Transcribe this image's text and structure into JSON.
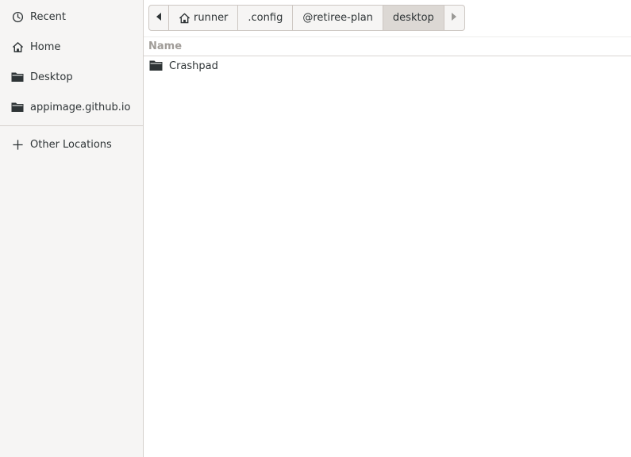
{
  "sidebar": {
    "items": [
      {
        "label": "Recent",
        "icon": "clock-icon"
      },
      {
        "label": "Home",
        "icon": "home-icon"
      },
      {
        "label": "Desktop",
        "icon": "folder-icon"
      },
      {
        "label": "appimage.github.io",
        "icon": "folder-icon"
      }
    ],
    "other_locations": {
      "label": "Other Locations",
      "icon": "plus-icon"
    }
  },
  "pathbar": {
    "segments": [
      {
        "label": "runner",
        "icon": "home-icon"
      },
      {
        "label": ".config"
      },
      {
        "label": "@retiree-plan"
      },
      {
        "label": "desktop",
        "active": true
      }
    ]
  },
  "list": {
    "columns": [
      "Name"
    ],
    "rows": [
      {
        "name": "Crashpad",
        "icon": "folder-icon"
      }
    ]
  },
  "colors": {
    "sidebar_bg": "#f6f5f4",
    "active_segment_bg": "#dcd8d4",
    "header_text": "#a09c98",
    "text": "#2e3436"
  }
}
